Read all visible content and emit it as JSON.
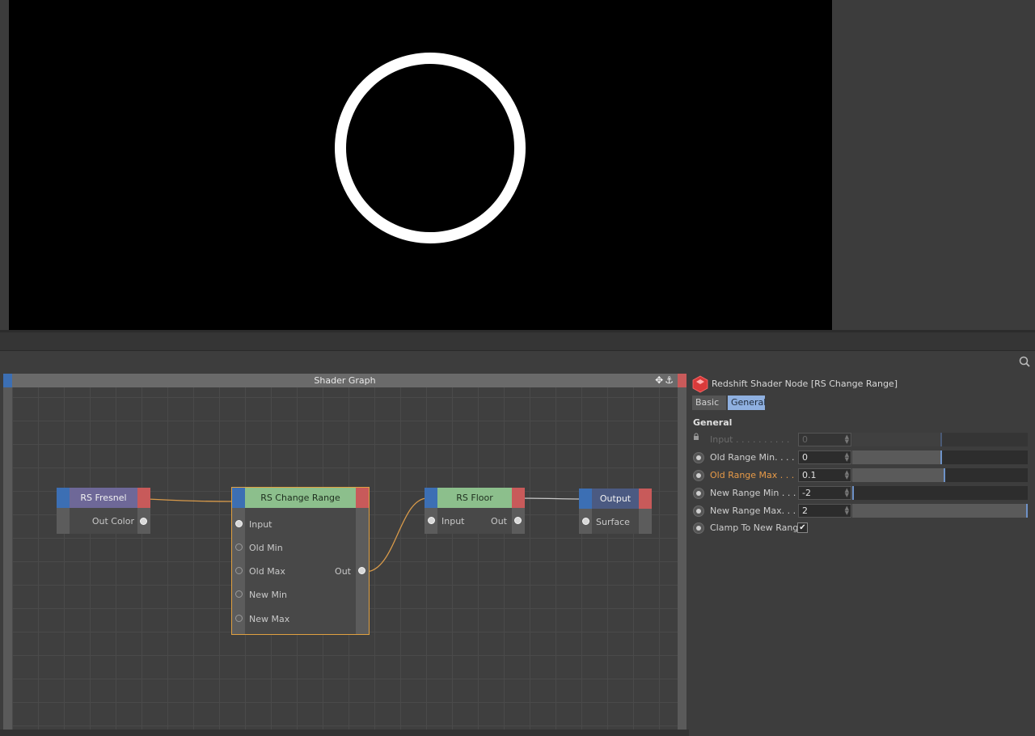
{
  "graph": {
    "title": "Shader Graph",
    "toolbar_icons": [
      "move-icon",
      "anchor-icon"
    ],
    "nodes": {
      "fresnel": {
        "title": "RS Fresnel",
        "header_color": "#6e6898",
        "out_label": "Out Color"
      },
      "change_range": {
        "title": "RS Change Range",
        "header_color": "#8cbf8c",
        "inputs": [
          "Input",
          "Old Min",
          "Old Max",
          "New Min",
          "New Max"
        ],
        "out_label": "Out",
        "selected": true
      },
      "floor": {
        "title": "RS Floor",
        "header_color": "#8cbf8c",
        "in_label": "Input",
        "out_label": "Out"
      },
      "output": {
        "title": "Output",
        "header_color": "#4b5a82",
        "in_label": "Surface"
      }
    },
    "colors": {
      "wire_active": "#d89a4a",
      "wire_plain": "#c8c8c8",
      "selection": "#e0a040"
    }
  },
  "attributes": {
    "title": "Redshift Shader Node [RS Change Range]",
    "tabs": [
      "Basic",
      "General"
    ],
    "active_tab": "General",
    "section": "General",
    "params": [
      {
        "label": "Input . . . . . . . . . .",
        "value": "0",
        "disabled": true,
        "slider_fraction": 0.5
      },
      {
        "label": "Old Range Min. . . .",
        "value": "0",
        "disabled": false,
        "slider_fraction": 0.5
      },
      {
        "label": "Old Range Max . . .",
        "value": "0.1",
        "disabled": false,
        "highlight": true,
        "slider_fraction": 0.52
      },
      {
        "label": "New Range Min . . .",
        "value": "-2",
        "disabled": false,
        "slider_fraction": 0.0
      },
      {
        "label": "New Range Max. . .",
        "value": "2",
        "disabled": false,
        "slider_fraction": 1.0
      }
    ],
    "checkbox_param": {
      "label": "Clamp To New Range",
      "checked": true,
      "mark": "✔"
    }
  },
  "render": {
    "background": "#000000",
    "ring_color": "#ffffff"
  }
}
